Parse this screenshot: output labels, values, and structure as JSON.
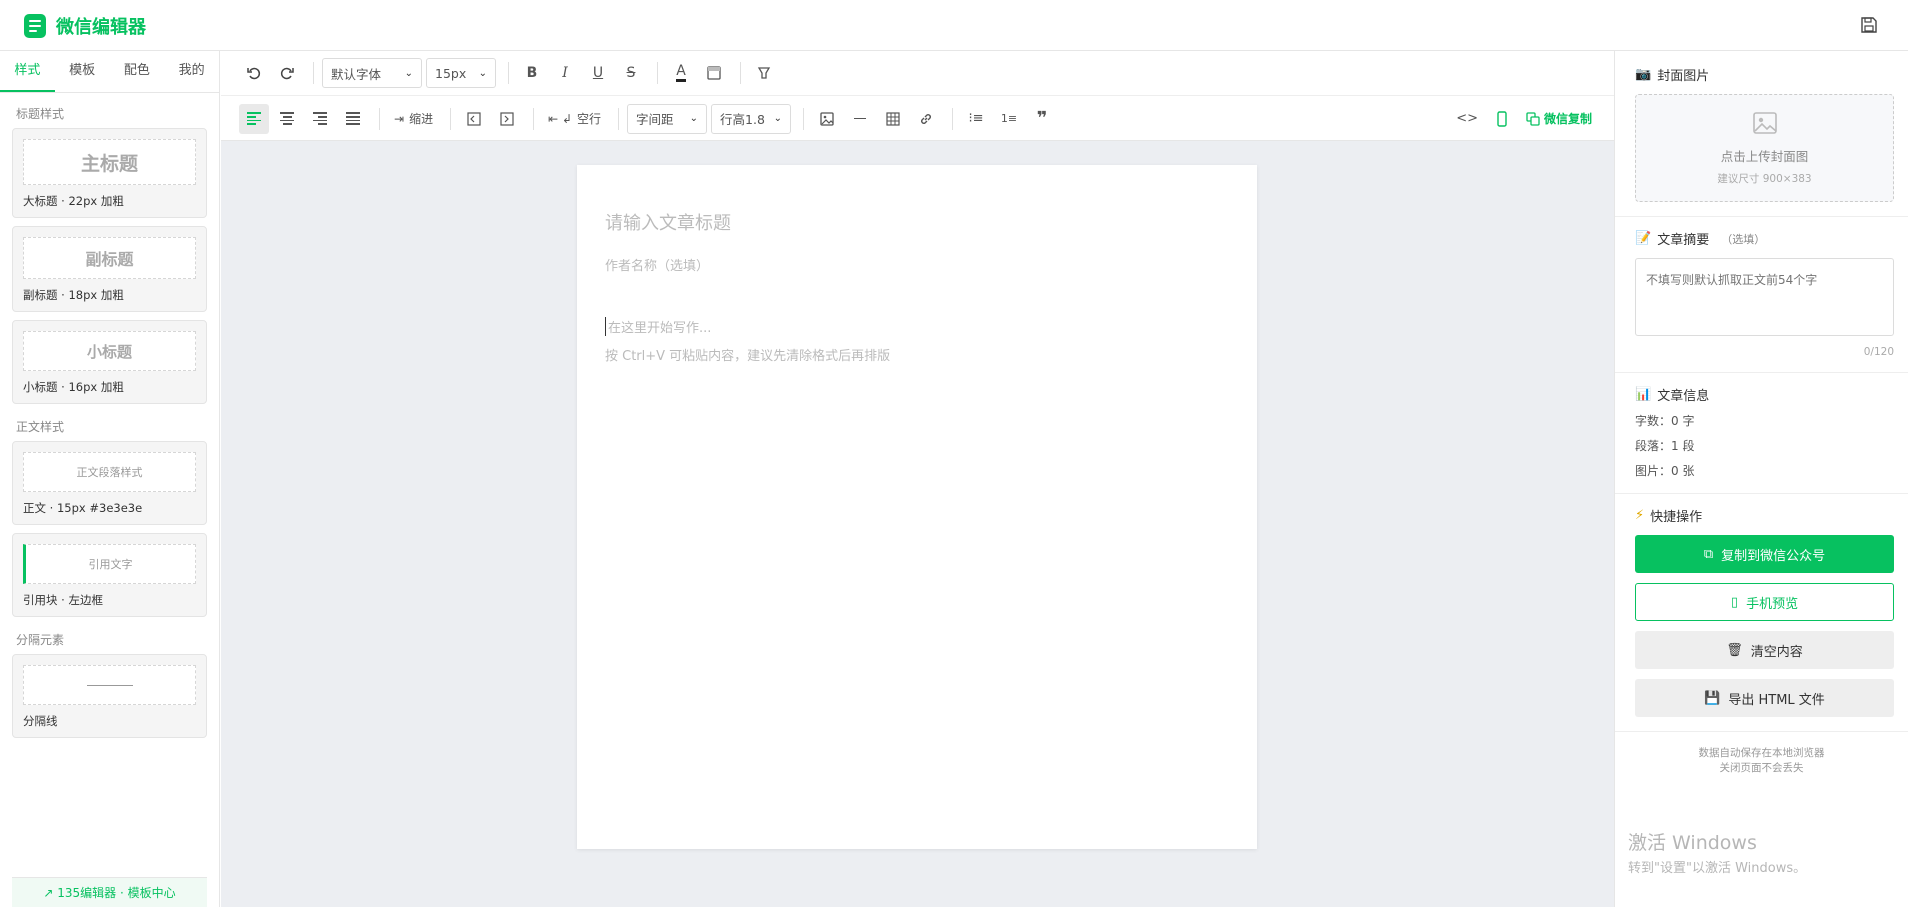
{
  "app": {
    "title": "微信编辑器"
  },
  "sidebar": {
    "tabs": [
      {
        "label": "样式"
      },
      {
        "label": "模板"
      },
      {
        "label": "配色"
      },
      {
        "label": "我的"
      }
    ],
    "heading_section": "标题样式",
    "heading_cards": [
      {
        "preview": "主标题",
        "caption": "大标题 · 22px 加粗"
      },
      {
        "preview": "副标题",
        "caption": "副标题 · 18px 加粗"
      },
      {
        "preview": "小标题",
        "caption": "小标题 · 16px 加粗"
      }
    ],
    "body_section": "正文样式",
    "body_cards": [
      {
        "preview": "正文段落样式",
        "caption": "正文 · 15px #3e3e3e"
      },
      {
        "preview": "引用文字",
        "caption": "引用块 · 左边框"
      }
    ],
    "divider_section": "分隔元素",
    "divider_card": {
      "caption": "分隔线"
    },
    "footer_link": "135编辑器 · 模板中心"
  },
  "toolbar": {
    "font_family": "默认字体",
    "font_size": "15px",
    "indent_label": "缩进",
    "empty_line_label": "空行",
    "letter_spacing": "字间距",
    "line_height": "行高1.8",
    "wechat_copy_label": "微信复制"
  },
  "editor": {
    "title_placeholder": "请输入文章标题",
    "author_placeholder": "作者名称（选填）",
    "body_placeholder": "在这里开始写作...",
    "hint": "按 Ctrl+V 可粘贴内容，建议先清除格式后再排版"
  },
  "right_panel": {
    "cover": {
      "title": "封面图片",
      "upload_text": "点击上传封面图",
      "size_hint": "建议尺寸 900×383"
    },
    "summary": {
      "title": "文章摘要",
      "optional": "（选填）",
      "placeholder": "不填写则默认抓取正文前54个字",
      "counter": "0/120"
    },
    "info": {
      "title": "文章信息",
      "words": "字数：0 字",
      "paragraphs": "段落：1 段",
      "images": "图片：0 张"
    },
    "quick": {
      "title": "快捷操作",
      "copy_wechat": "复制到微信公众号",
      "mobile_preview": "手机预览",
      "clear": "清空内容",
      "export": "导出 HTML 文件"
    },
    "note_line1": "数据自动保存在本地浏览器",
    "note_line2": "关闭页面不会丢失"
  },
  "os_watermark": {
    "line1": "激活 Windows",
    "line2": "转到\"设置\"以激活 Windows。"
  },
  "colors": {
    "accent": "#07c160",
    "canvas": "#eceef2"
  }
}
